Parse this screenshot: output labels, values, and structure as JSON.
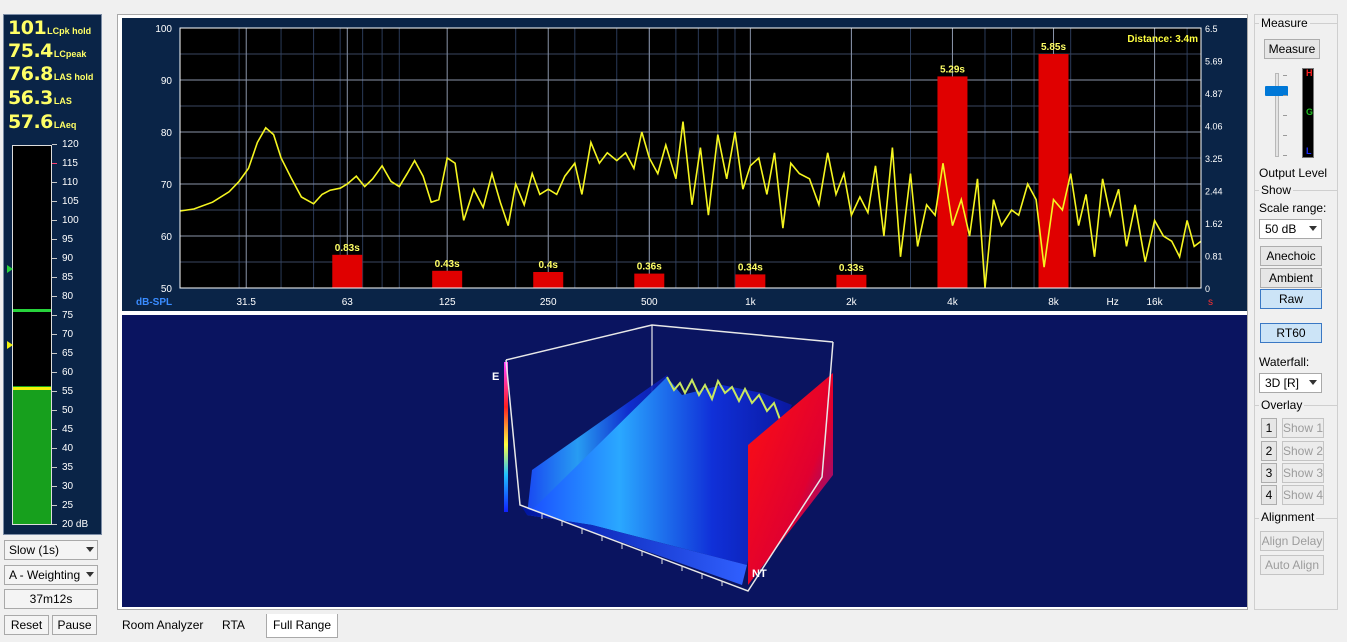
{
  "readouts": [
    {
      "value": "101",
      "label": "LCpk hold"
    },
    {
      "value": "75.4",
      "label": "LCpeak"
    },
    {
      "value": "76.8",
      "label": "LAS hold"
    },
    {
      "value": "56.3",
      "label": "LAS"
    },
    {
      "value": "57.6",
      "label": "LAeq"
    }
  ],
  "meter": {
    "ticks": [
      "120",
      "115",
      "110",
      "105",
      "100",
      "95",
      "90",
      "85",
      "80",
      "75",
      "70",
      "65",
      "60",
      "55",
      "50",
      "45",
      "40",
      "35",
      "30",
      "25",
      "20 dB"
    ],
    "min_db": 20,
    "max_db": 120,
    "level_db": 56.3,
    "hold_db": 76.8,
    "peak_marker_db": 87.5,
    "las_marker_db": 67.5,
    "fill_color": "#17a01d",
    "peak_color": "#f2f20a",
    "hold_color": "#27d33c"
  },
  "controls": {
    "response": "Slow (1s)",
    "weighting": "A - Weighting",
    "elapsed": "37m12s",
    "reset_label": "Reset",
    "pause_label": "Pause"
  },
  "tabs": [
    {
      "label": "Room Analyzer",
      "active": false
    },
    {
      "label": "RTA",
      "active": false
    },
    {
      "label": "Full Range",
      "active": true
    }
  ],
  "right_panel": {
    "measure_group": "Measure",
    "measure_button": "Measure",
    "output_level_label": "Output Level",
    "output_level_fraction": 0.78,
    "level_labels": [
      "H",
      "G",
      "L"
    ],
    "level_label_colors": [
      "#ff2020",
      "#20c020",
      "#2030ff"
    ],
    "show_group": "Show",
    "scale_range_label": "Scale range:",
    "scale_range_value": "50 dB",
    "anechoic": "Anechoic",
    "ambient": "Ambient",
    "raw": "Raw",
    "rt60": "RT60",
    "waterfall_label": "Waterfall:",
    "waterfall_value": "3D [R]",
    "overlay_group": "Overlay",
    "overlays": [
      {
        "num": "1",
        "label": "Show 1"
      },
      {
        "num": "2",
        "label": "Show 2"
      },
      {
        "num": "3",
        "label": "Show 3"
      },
      {
        "num": "4",
        "label": "Show 4"
      }
    ],
    "alignment_group": "Alignment",
    "align_delay": "Align Delay",
    "auto_align": "Auto Align"
  },
  "chart_data": {
    "type": "line",
    "xlabel": "Hz",
    "ylabel": "dB-SPL",
    "y2label": "s",
    "annotation": "Distance: 3.4m",
    "xlim": [
      20,
      22000
    ],
    "ylim": [
      50,
      100
    ],
    "y2lim": [
      0,
      6.5
    ],
    "x_ticks": [
      {
        "label": "31.5",
        "f": 31.5
      },
      {
        "label": "63",
        "f": 63
      },
      {
        "label": "125",
        "f": 125
      },
      {
        "label": "250",
        "f": 250
      },
      {
        "label": "500",
        "f": 500
      },
      {
        "label": "1k",
        "f": 1000
      },
      {
        "label": "2k",
        "f": 2000
      },
      {
        "label": "4k",
        "f": 4000
      },
      {
        "label": "8k",
        "f": 8000
      },
      {
        "label": "16k",
        "f": 16000
      }
    ],
    "y_ticks": [
      "100",
      "90",
      "80",
      "70",
      "60",
      "50"
    ],
    "y2_ticks": [
      "6.5",
      "5.69",
      "4.87",
      "4.06",
      "3.25",
      "2.44",
      "1.62",
      "0.81",
      "0"
    ],
    "grid": true,
    "series": [
      {
        "kind": "bar",
        "categories": [
          "63",
          "125",
          "250",
          "500",
          "1k",
          "2k",
          "4k",
          "8k"
        ],
        "freqs": [
          63,
          125,
          250,
          500,
          1000,
          2000,
          4000,
          8000
        ],
        "values": [
          0.83,
          0.43,
          0.4,
          0.36,
          0.34,
          0.33,
          5.29,
          5.85
        ],
        "labels": [
          "0.83s",
          "0.43s",
          "0.4s",
          "0.36s",
          "0.34s",
          "0.33s",
          "5.29s",
          "5.85s"
        ],
        "color": "#e00000"
      },
      {
        "kind": "line",
        "color": "#f5f520",
        "x": [
          20,
          22,
          25,
          28,
          30,
          32,
          34,
          36,
          38,
          40,
          43,
          46,
          50,
          53,
          56,
          60,
          63,
          67,
          71,
          75,
          80,
          85,
          90,
          95,
          100,
          106,
          112,
          118,
          125,
          132,
          140,
          150,
          160,
          170,
          180,
          190,
          200,
          212,
          224,
          236,
          250,
          265,
          280,
          300,
          315,
          335,
          355,
          375,
          400,
          425,
          450,
          475,
          500,
          530,
          560,
          600,
          630,
          670,
          710,
          750,
          800,
          850,
          900,
          950,
          1000,
          1060,
          1120,
          1180,
          1250,
          1320,
          1400,
          1500,
          1600,
          1700,
          1800,
          1900,
          2000,
          2120,
          2240,
          2360,
          2500,
          2650,
          2800,
          3000,
          3150,
          3350,
          3550,
          3750,
          4000,
          4250,
          4500,
          4750,
          5000,
          5300,
          5600,
          6000,
          6300,
          6700,
          7100,
          7500,
          8000,
          8500,
          9000,
          9500,
          10000,
          10600,
          11200,
          11800,
          12500,
          13200,
          14000,
          15000,
          16000,
          17000,
          18000,
          19000,
          20000,
          21000,
          22000
        ],
        "y": [
          64.8,
          65.2,
          66.5,
          68.5,
          70.5,
          73,
          78,
          80.8,
          79.5,
          75,
          71,
          67.5,
          66.2,
          68,
          68.8,
          69.2,
          70,
          71.5,
          69.5,
          71,
          73.5,
          70.5,
          69.5,
          72,
          74.5,
          71.5,
          66.5,
          67,
          75,
          74,
          63,
          69,
          65.5,
          72,
          66.5,
          62,
          70,
          66,
          72,
          68,
          69,
          68,
          71.5,
          74,
          68,
          78,
          74,
          76,
          74.5,
          76,
          73,
          80,
          75,
          72,
          77.5,
          71,
          82,
          66,
          77,
          64,
          79.5,
          71,
          80,
          69,
          73.5,
          75,
          68,
          76,
          61.5,
          74,
          72,
          71,
          66,
          76,
          68,
          72,
          64,
          67.5,
          64.5,
          73.5,
          60,
          77,
          56,
          72,
          58,
          66,
          64,
          74,
          62,
          67,
          60,
          71,
          50,
          67,
          62,
          65,
          64,
          70,
          67,
          54,
          67,
          65,
          72,
          62,
          68,
          56,
          71,
          64,
          69,
          58,
          66,
          55,
          63,
          60,
          59,
          56,
          63,
          58,
          59
        ]
      }
    ]
  },
  "waterfall": {
    "axis_label_e": "E",
    "axis_label_nt": "NT"
  }
}
